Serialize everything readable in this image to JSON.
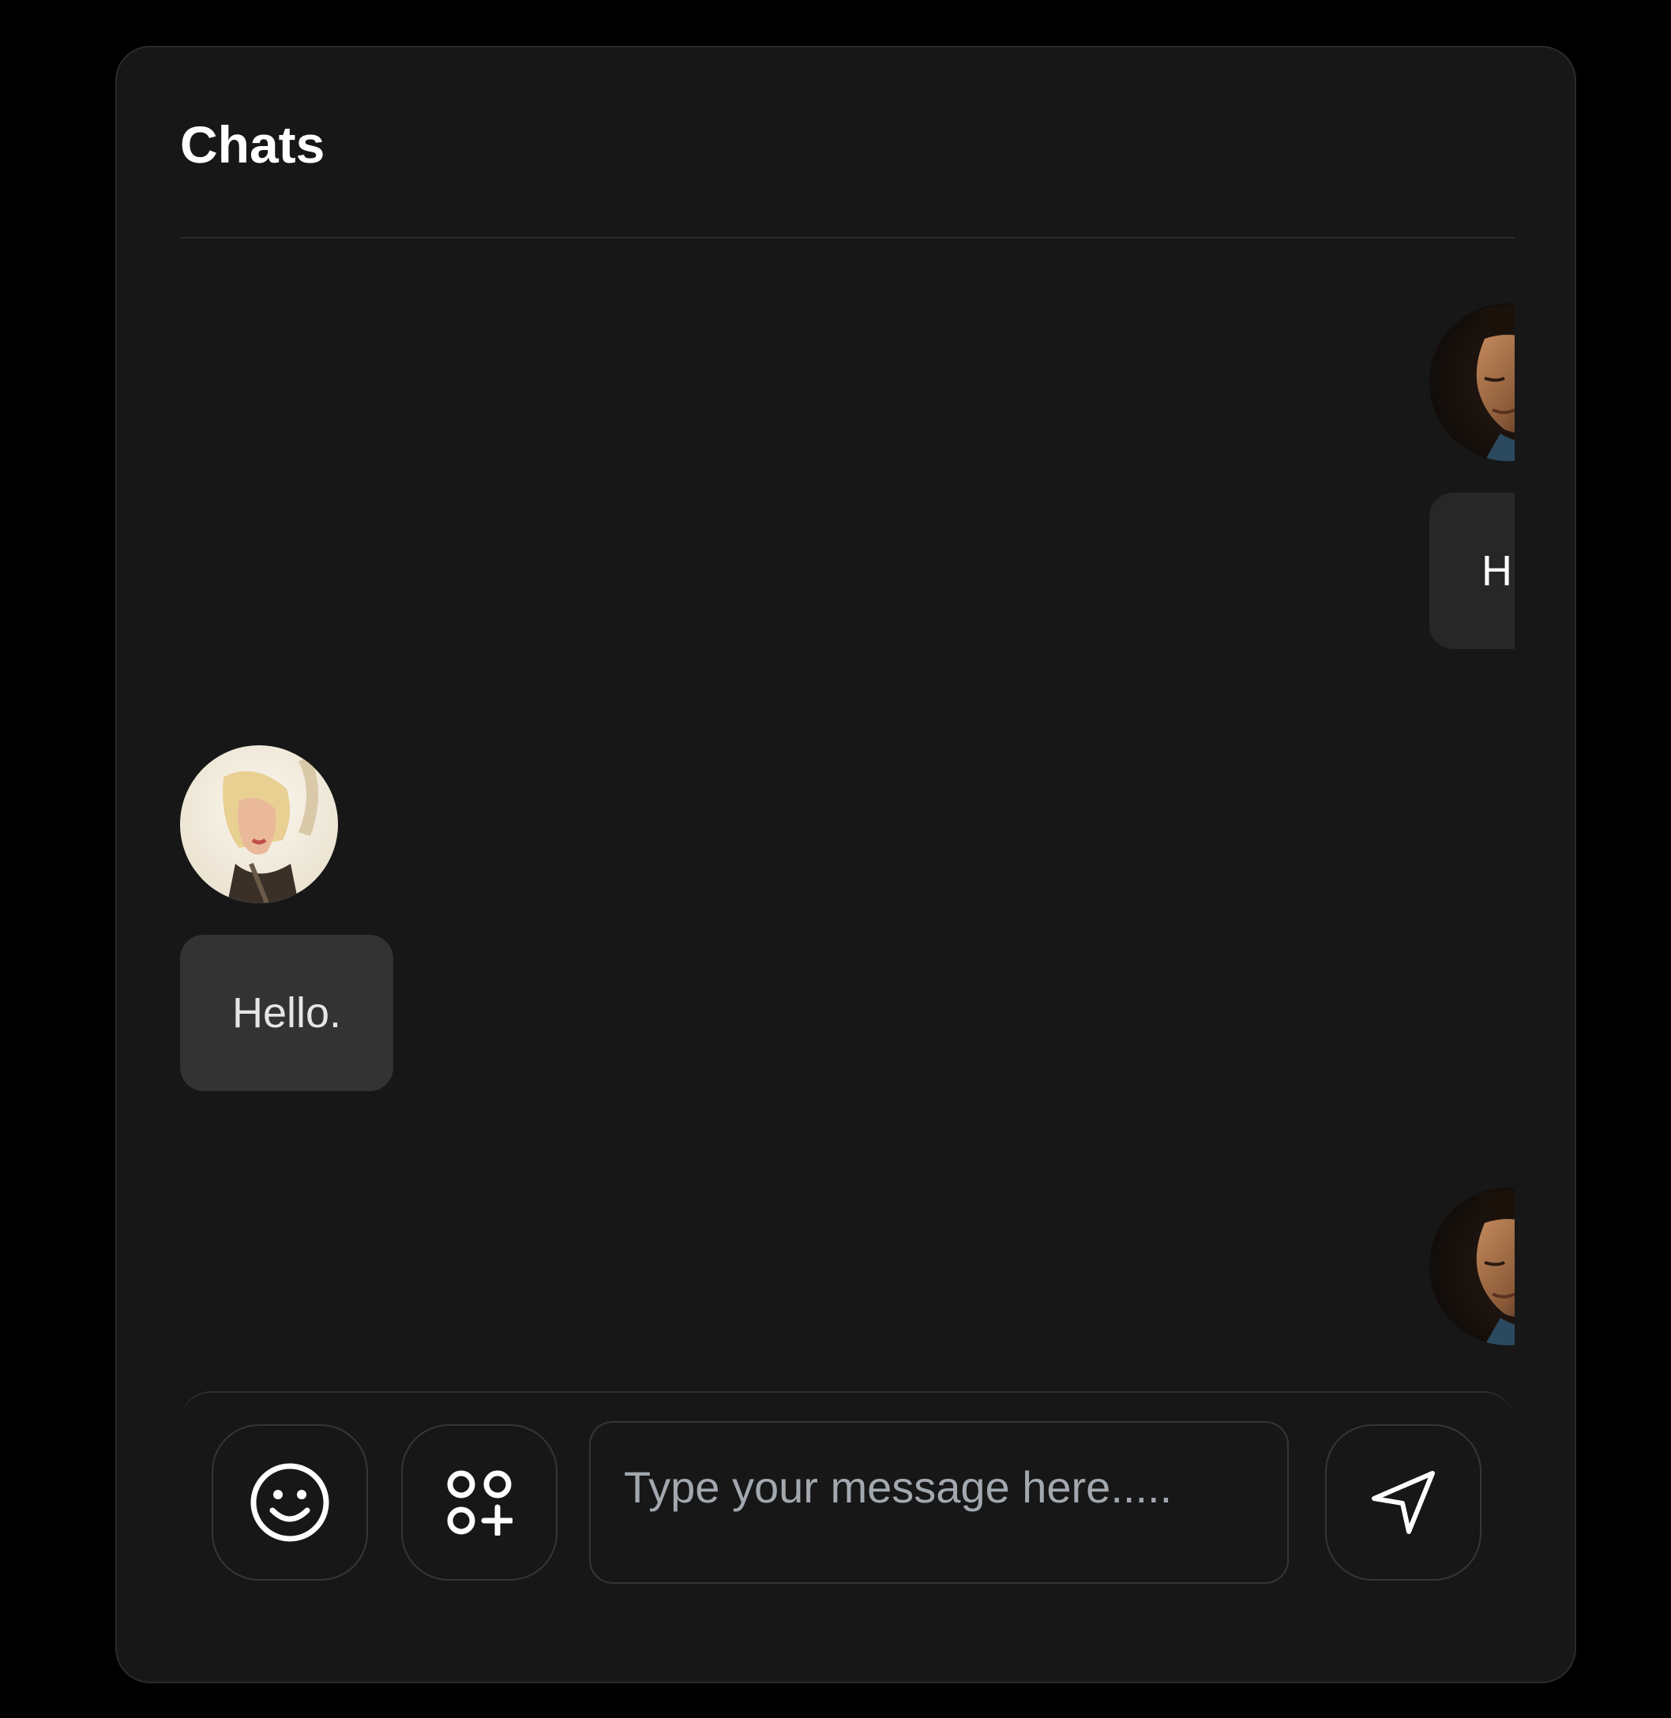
{
  "header": {
    "title": "Chats"
  },
  "messages": [
    {
      "side": "right",
      "sender_avatar": "man-avatar",
      "text": "Hi."
    },
    {
      "side": "left",
      "sender_avatar": "woman-avatar",
      "text": "Hello."
    },
    {
      "side": "right",
      "sender_avatar": "man-avatar",
      "text": ""
    }
  ],
  "composer": {
    "placeholder": "Type your message here.....",
    "value": "",
    "buttons": {
      "emoji": "smiley-icon",
      "attach": "apps-add-icon",
      "send": "send-icon"
    }
  },
  "colors": {
    "page_background": "#000000",
    "card_background": "#171717",
    "bubble_sent": "#272727",
    "bubble_received": "#333333",
    "text": "#ffffff",
    "placeholder": "#a2a8ae"
  }
}
